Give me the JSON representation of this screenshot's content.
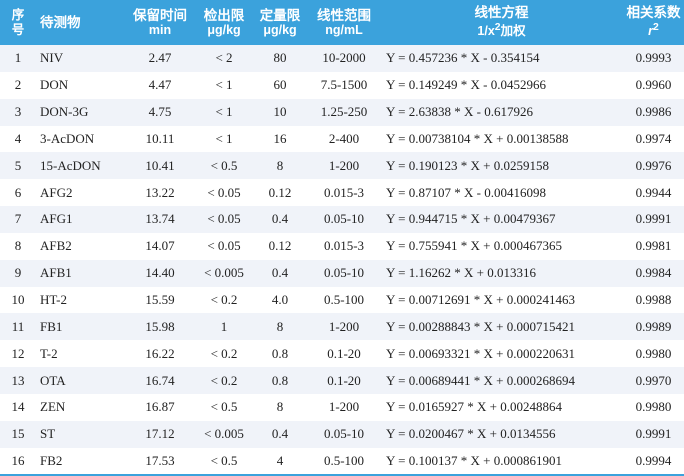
{
  "table": {
    "headers": {
      "no": [
        "序",
        "号"
      ],
      "analyte": "待测物",
      "retention": {
        "title": "保留时间",
        "unit": "min"
      },
      "lod": {
        "title": "检出限",
        "unit": "μg/kg"
      },
      "loq": {
        "title": "定量限",
        "unit": "μg/kg"
      },
      "range": {
        "title": "线性范围",
        "unit": "ng/mL"
      },
      "equation": {
        "title": "线性方程",
        "unit_prefix": "1/x",
        "unit_sup": "2",
        "unit_suffix": "加权"
      },
      "r2": {
        "title": "相关系数",
        "unit_base": "r",
        "unit_sup": "2"
      }
    },
    "rows": [
      {
        "no": "1",
        "analyte": "NIV",
        "rt": "2.47",
        "lod": "< 2",
        "loq": "80",
        "range": "10-2000",
        "eq": "Y = 0.457236 * X - 0.354154",
        "r2": "0.9993"
      },
      {
        "no": "2",
        "analyte": "DON",
        "rt": "4.47",
        "lod": "< 1",
        "loq": "60",
        "range": "7.5-1500",
        "eq": "Y = 0.149249 * X - 0.0452966",
        "r2": "0.9960"
      },
      {
        "no": "3",
        "analyte": "DON-3G",
        "rt": "4.75",
        "lod": "< 1",
        "loq": "10",
        "range": "1.25-250",
        "eq": "Y = 2.63838 * X - 0.617926",
        "r2": "0.9986"
      },
      {
        "no": "4",
        "analyte": "3-AcDON",
        "rt": "10.11",
        "lod": "< 1",
        "loq": "16",
        "range": "2-400",
        "eq": "Y = 0.00738104 * X + 0.00138588",
        "r2": "0.9974"
      },
      {
        "no": "5",
        "analyte": "15-AcDON",
        "rt": "10.41",
        "lod": "< 0.5",
        "loq": "8",
        "range": "1-200",
        "eq": "Y = 0.190123 * X + 0.0259158",
        "r2": "0.9976"
      },
      {
        "no": "6",
        "analyte": "AFG2",
        "rt": "13.22",
        "lod": "< 0.05",
        "loq": "0.12",
        "range": "0.015-3",
        "eq": "Y = 0.87107 * X - 0.00416098",
        "r2": "0.9944"
      },
      {
        "no": "7",
        "analyte": "AFG1",
        "rt": "13.74",
        "lod": "< 0.05",
        "loq": "0.4",
        "range": "0.05-10",
        "eq": "Y = 0.944715 * X + 0.00479367",
        "r2": "0.9991"
      },
      {
        "no": "8",
        "analyte": "AFB2",
        "rt": "14.07",
        "lod": "< 0.05",
        "loq": "0.12",
        "range": "0.015-3",
        "eq": "Y = 0.755941 * X + 0.000467365",
        "r2": "0.9981"
      },
      {
        "no": "9",
        "analyte": "AFB1",
        "rt": "14.40",
        "lod": "< 0.005",
        "loq": "0.4",
        "range": "0.05-10",
        "eq": "Y = 1.16262 * X + 0.013316",
        "r2": "0.9984"
      },
      {
        "no": "10",
        "analyte": "HT-2",
        "rt": "15.59",
        "lod": "< 0.2",
        "loq": "4.0",
        "range": "0.5-100",
        "eq": "Y = 0.00712691 * X + 0.000241463",
        "r2": "0.9988"
      },
      {
        "no": "11",
        "analyte": "FB1",
        "rt": "15.98",
        "lod": "1",
        "loq": "8",
        "range": "1-200",
        "eq": "Y = 0.00288843 * X + 0.000715421",
        "r2": "0.9989"
      },
      {
        "no": "12",
        "analyte": "T-2",
        "rt": "16.22",
        "lod": "< 0.2",
        "loq": "0.8",
        "range": "0.1-20",
        "eq": "Y = 0.00693321 * X + 0.000220631",
        "r2": "0.9980"
      },
      {
        "no": "13",
        "analyte": "OTA",
        "rt": "16.74",
        "lod": "< 0.2",
        "loq": "0.8",
        "range": "0.1-20",
        "eq": "Y = 0.00689441 * X + 0.000268694",
        "r2": "0.9970"
      },
      {
        "no": "14",
        "analyte": "ZEN",
        "rt": "16.87",
        "lod": "< 0.5",
        "loq": "8",
        "range": "1-200",
        "eq": "Y = 0.0165927 * X + 0.00248864",
        "r2": "0.9980"
      },
      {
        "no": "15",
        "analyte": "ST",
        "rt": "17.12",
        "lod": "< 0.005",
        "loq": "0.4",
        "range": "0.05-10",
        "eq": "Y = 0.0200467 * X + 0.0134556",
        "r2": "0.9991"
      },
      {
        "no": "16",
        "analyte": "FB2",
        "rt": "17.53",
        "lod": "< 0.5",
        "loq": "4",
        "range": "0.5-100",
        "eq": "Y = 0.100137 * X + 0.000861901",
        "r2": "0.9994"
      }
    ]
  },
  "colors": {
    "header_bg": "#3ba2dc",
    "header_text": "#ffffff",
    "row_stripe": "#f0f3f9",
    "row_plain": "#ffffff",
    "body_text": "#222222"
  }
}
